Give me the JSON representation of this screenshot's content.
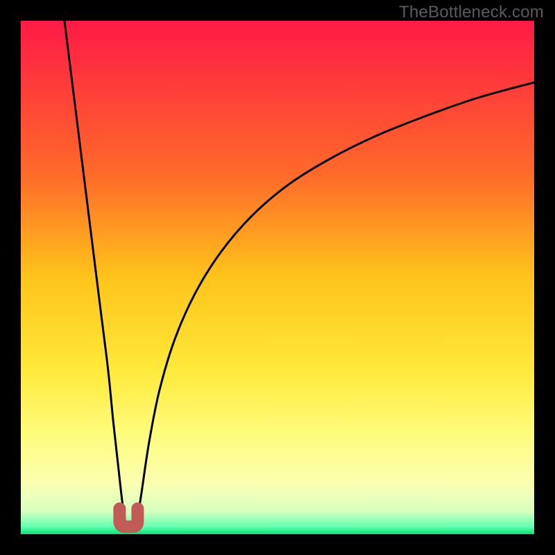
{
  "watermark": "TheBottleneck.com",
  "chart_data": {
    "type": "line",
    "title": "",
    "xlabel": "",
    "ylabel": "",
    "xlim": [
      0,
      100
    ],
    "ylim": [
      0,
      100
    ],
    "grid": false,
    "legend_position": "none",
    "annotations": [
      {
        "name": "optimal-marker",
        "x": 21,
        "y": 2,
        "color": "#c15b55"
      }
    ],
    "gradient_stops": [
      {
        "offset": 0.0,
        "color": "#ff1a46"
      },
      {
        "offset": 0.12,
        "color": "#ff3a3a"
      },
      {
        "offset": 0.3,
        "color": "#ff6a2a"
      },
      {
        "offset": 0.5,
        "color": "#ffc41a"
      },
      {
        "offset": 0.68,
        "color": "#ffe93a"
      },
      {
        "offset": 0.8,
        "color": "#fffb7a"
      },
      {
        "offset": 0.9,
        "color": "#fbffb0"
      },
      {
        "offset": 0.955,
        "color": "#d8ffc0"
      },
      {
        "offset": 0.985,
        "color": "#66ffb0"
      },
      {
        "offset": 1.0,
        "color": "#00e676"
      }
    ],
    "series": [
      {
        "name": "left-branch",
        "x": [
          8.5,
          9.5,
          11,
          12.5,
          14,
          15.5,
          17,
          18,
          19,
          19.8,
          20.5
        ],
        "values": [
          100,
          92,
          80,
          68,
          56,
          44,
          32,
          22,
          13,
          6,
          1.5
        ]
      },
      {
        "name": "right-branch",
        "x": [
          22.5,
          23.5,
          25,
          27,
          30,
          34,
          39,
          45,
          52,
          60,
          69,
          79,
          89,
          100
        ],
        "values": [
          1.5,
          8,
          18,
          28,
          38,
          47,
          55,
          62,
          68,
          73,
          77.5,
          81.5,
          85,
          88
        ]
      }
    ]
  }
}
